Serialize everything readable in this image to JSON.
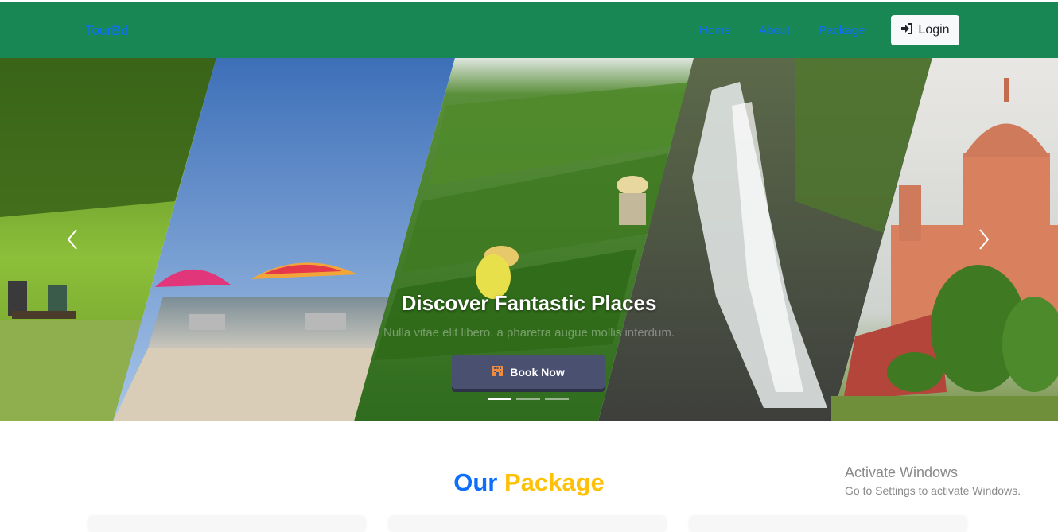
{
  "navbar": {
    "brand": "TourBd",
    "links": [
      "Home",
      "About",
      "Package"
    ],
    "login_label": "Login",
    "colors": {
      "background": "#198754",
      "link": "#0d6efd"
    }
  },
  "hero": {
    "title": "Discover Fantastic Places",
    "subtitle": "Nulla vitae elit libero, a pharetra augue mollis interdum.",
    "book_label": "Book Now",
    "indicators": [
      "slide-1",
      "slide-2",
      "slide-3"
    ],
    "active_indicator": 1,
    "icons": [
      "chevron-left-icon",
      "chevron-right-icon",
      "hotel-icon"
    ]
  },
  "section": {
    "title_part1": "Our",
    "title_part2": "Package",
    "colors": {
      "part1": "#0d6efd",
      "part2": "#ffc107"
    }
  },
  "watermark": {
    "line1": "Activate Windows",
    "line2": "Go to Settings to activate Windows."
  }
}
